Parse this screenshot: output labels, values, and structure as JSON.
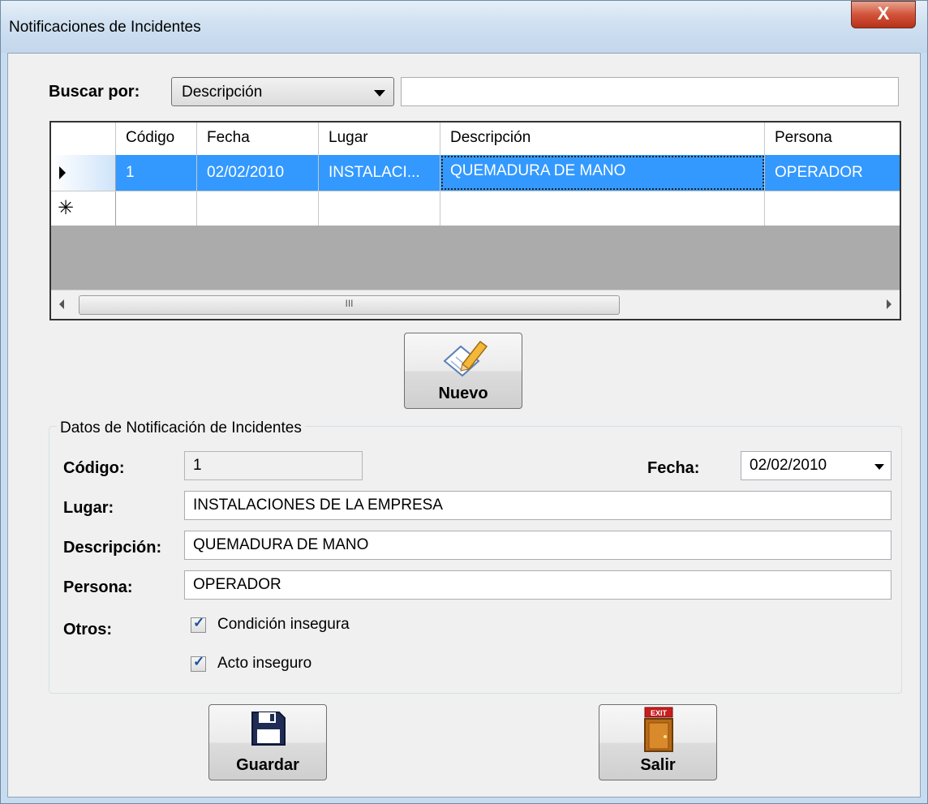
{
  "window": {
    "title": "Notificaciones de Incidentes",
    "close_glyph": "X"
  },
  "search": {
    "label": "Buscar por:",
    "field_selected": "Descripción",
    "query_value": ""
  },
  "grid": {
    "columns": [
      "Código",
      "Fecha",
      "Lugar",
      "Descripción",
      "Persona"
    ],
    "rows": [
      {
        "codigo": "1",
        "fecha": "02/02/2010",
        "lugar": "INSTALACI...",
        "descripcion": "QUEMADURA DE MANO",
        "persona": "OPERADOR"
      }
    ],
    "new_row_marker": "✳",
    "scroll_grip": "III"
  },
  "buttons": {
    "nuevo": "Nuevo",
    "guardar": "Guardar",
    "salir": "Salir",
    "exit_sign": "EXIT"
  },
  "form": {
    "group_title": "Datos de Notificación de Incidentes",
    "codigo_label": "Código:",
    "codigo_value": "1",
    "fecha_label": "Fecha:",
    "fecha_value": "02/02/2010",
    "lugar_label": "Lugar:",
    "lugar_value": "INSTALACIONES DE LA EMPRESA",
    "descripcion_label": "Descripción:",
    "descripcion_value": "QUEMADURA DE MANO",
    "persona_label": "Persona:",
    "persona_value": "OPERADOR",
    "otros_label": "Otros:",
    "chk1_label": "Condición insegura",
    "chk1_checked": true,
    "chk2_label": "Acto inseguro",
    "chk2_checked": true
  },
  "colors": {
    "selection": "#3399ff",
    "title_bar": "#c3d7ec",
    "close_button": "#c94a31"
  }
}
